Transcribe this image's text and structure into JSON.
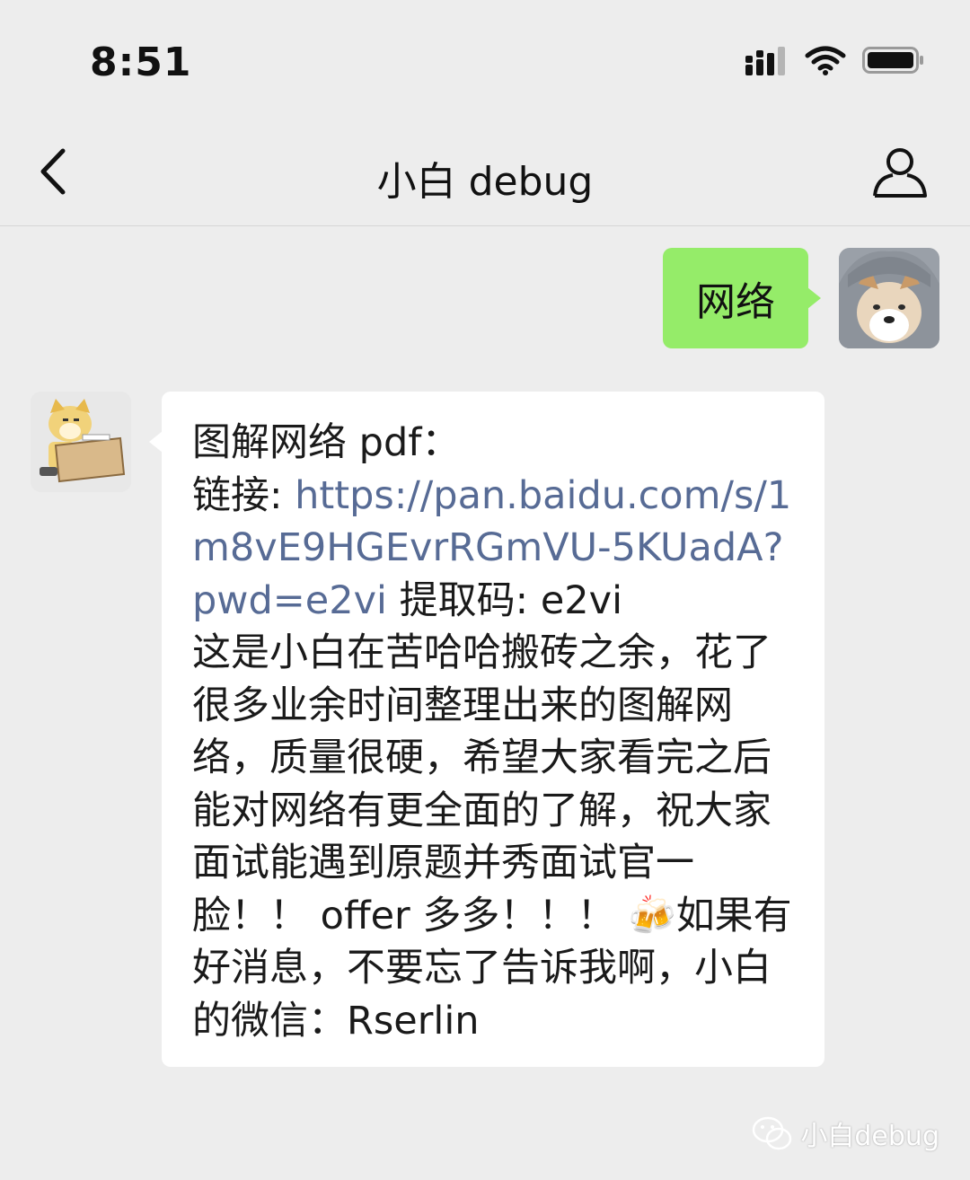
{
  "status_bar": {
    "time": "8:51"
  },
  "nav": {
    "title": "小白 debug"
  },
  "messages": {
    "sent": {
      "text": "网络"
    },
    "received": {
      "line1": "图解网络 pdf：",
      "link_label": "链接: ",
      "link_url": "https://pan.baidu.com/s/1m8vE9HGEvrRGmVU-5KUadA?pwd=e2vi",
      "code_text": " 提取码: e2vi",
      "body": "这是小白在苦哈哈搬砖之余，花了很多业余时间整理出来的图解网络，质量很硬，希望大家看完之后能对网络有更全面的了解，祝大家面试能遇到原题并秀面试官一脸！！ offer 多多！！！ 🍻如果有好消息，不要忘了告诉我啊，小白的微信：Rserlin"
    }
  },
  "watermark": {
    "text": "小白debug"
  },
  "colors": {
    "background": "#ededed",
    "sent_bubble": "#95ec69",
    "received_bubble": "#ffffff",
    "link": "#576b95"
  },
  "icons": {
    "back": "chevron-left-icon",
    "profile": "person-icon",
    "signal": "cellular-signal-icon",
    "wifi": "wifi-icon",
    "battery": "battery-icon",
    "wechat": "wechat-logo-icon"
  }
}
